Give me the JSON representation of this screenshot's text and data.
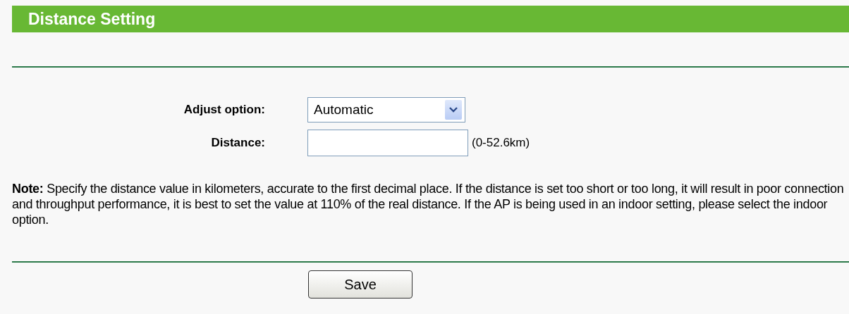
{
  "header": {
    "title": "Distance Setting"
  },
  "form": [
    {
      "kind": "select",
      "label": "Adjust option:",
      "value": "Automatic"
    },
    {
      "kind": "text",
      "label": "Distance:",
      "hint": "(0-52.6km)"
    }
  ],
  "note": "**Note:** Specify the distance value in kilometers, accurate to the first decimal place. If the distance is set too short or too long, it will result in poor connection and throughput performance, it is best to set the value at 110% of the real distance. If the AP is being used in an indoor setting, please select the indoor option.",
  "buttons": [
    "Save"
  ]
}
